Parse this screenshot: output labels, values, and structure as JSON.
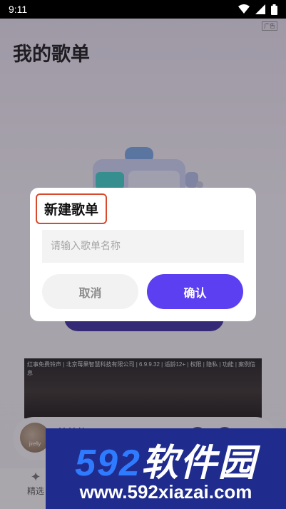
{
  "status_bar": {
    "time": "9:11",
    "icons": [
      "wifi-icon",
      "signal-icon",
      "battery-icon"
    ]
  },
  "page": {
    "title": "我的歌单",
    "ad_badge": "广告"
  },
  "ad_banner": {
    "text": "红事免费铃声 | 北京莓果智慧科技有限公司 | 6.9.9.32 | 适龄12+ | 权限 | 隐私 | 功能 | 案例信息"
  },
  "player": {
    "avatar_label": "jirefly",
    "song_name": "美美的"
  },
  "bottom_nav": {
    "items": [
      {
        "label": "精选",
        "icon": "sparkle-icon"
      }
    ]
  },
  "dialog": {
    "title": "新建歌单",
    "input_placeholder": "请输入歌单名称",
    "input_value": "",
    "cancel_label": "取消",
    "confirm_label": "确认"
  },
  "watermark": {
    "brand_number": "592",
    "brand_text": "软件园",
    "url": "www.592xiazai.com"
  },
  "colors": {
    "confirm_button": "#5b3ff0",
    "title_highlight_border": "#d84a2c",
    "watermark_bg": "#1f2c8e",
    "watermark_number": "#2f7bff"
  }
}
